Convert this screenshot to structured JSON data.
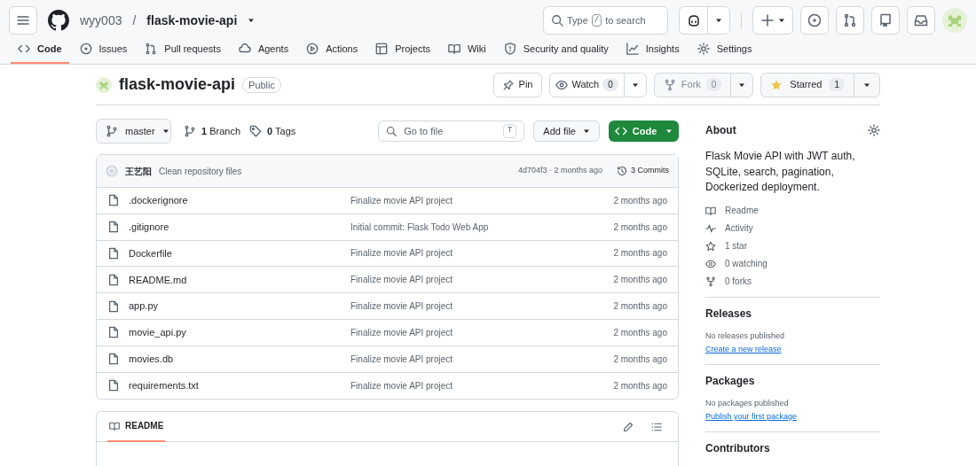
{
  "header": {
    "owner": "wyy003",
    "separator": "/",
    "repo": "flask-movie-api",
    "search": {
      "placeholder_start": "Type",
      "shortcut": "/",
      "placeholder_end": "to search"
    }
  },
  "tabs": [
    {
      "label": "Code",
      "selected": true
    },
    {
      "label": "Issues",
      "selected": false
    },
    {
      "label": "Pull requests",
      "selected": false
    },
    {
      "label": "Agents",
      "selected": false
    },
    {
      "label": "Actions",
      "selected": false
    },
    {
      "label": "Projects",
      "selected": false
    },
    {
      "label": "Wiki",
      "selected": false
    },
    {
      "label": "Security and quality",
      "selected": false
    },
    {
      "label": "Insights",
      "selected": false
    },
    {
      "label": "Settings",
      "selected": false
    }
  ],
  "repo": {
    "name": "flask-movie-api",
    "visibility": "Public",
    "pin": "Pin",
    "watch": {
      "label": "Watch",
      "count": "0"
    },
    "fork": {
      "label": "Fork",
      "count": "0",
      "disabled": true
    },
    "star": {
      "label": "Starred",
      "count": "1",
      "starred": true
    }
  },
  "toolbar": {
    "branch": "master",
    "branches": {
      "count": "1",
      "label": "Branch"
    },
    "tags": {
      "count": "0",
      "label": "Tags"
    },
    "go_to_file": {
      "placeholder": "Go to file",
      "key": "T"
    },
    "add_file": "Add file",
    "code": "Code"
  },
  "commit": {
    "author": "王艺阳",
    "message": "Clean repository files",
    "meta": "4d704f3 · 2 months ago",
    "commits": "3 Commits"
  },
  "files": [
    {
      "name": ".dockerignore",
      "message": "Finalize movie API project",
      "time": "2 months ago"
    },
    {
      "name": ".gitignore",
      "message": "Initial commit: Flask Todo Web App",
      "time": "2 months ago"
    },
    {
      "name": "Dockerfile",
      "message": "Finalize movie API project",
      "time": "2 months ago"
    },
    {
      "name": "README.md",
      "message": "Finalize movie API project",
      "time": "2 months ago"
    },
    {
      "name": "app.py",
      "message": "Finalize movie API project",
      "time": "2 months ago"
    },
    {
      "name": "movie_api.py",
      "message": "Finalize movie API project",
      "time": "2 months ago"
    },
    {
      "name": "movies.db",
      "message": "Finalize movie API project",
      "time": "2 months ago"
    },
    {
      "name": "requirements.txt",
      "message": "Finalize movie API project",
      "time": "2 months ago"
    }
  ],
  "readme": {
    "tab": "README"
  },
  "about": {
    "title": "About",
    "description": "Flask Movie API with JWT auth, SQLite, search, pagination, Dockerized deployment.",
    "links": [
      {
        "label": "Readme"
      },
      {
        "label": "Activity"
      },
      {
        "label": "1 star"
      },
      {
        "label": "0 watching"
      },
      {
        "label": "0 forks"
      }
    ]
  },
  "sections": [
    {
      "title": "Releases",
      "note": "No releases published",
      "link": "Create a new release"
    },
    {
      "title": "Packages",
      "note": "No packages published",
      "link": "Publish your first package"
    },
    {
      "title": "Contributors"
    }
  ]
}
